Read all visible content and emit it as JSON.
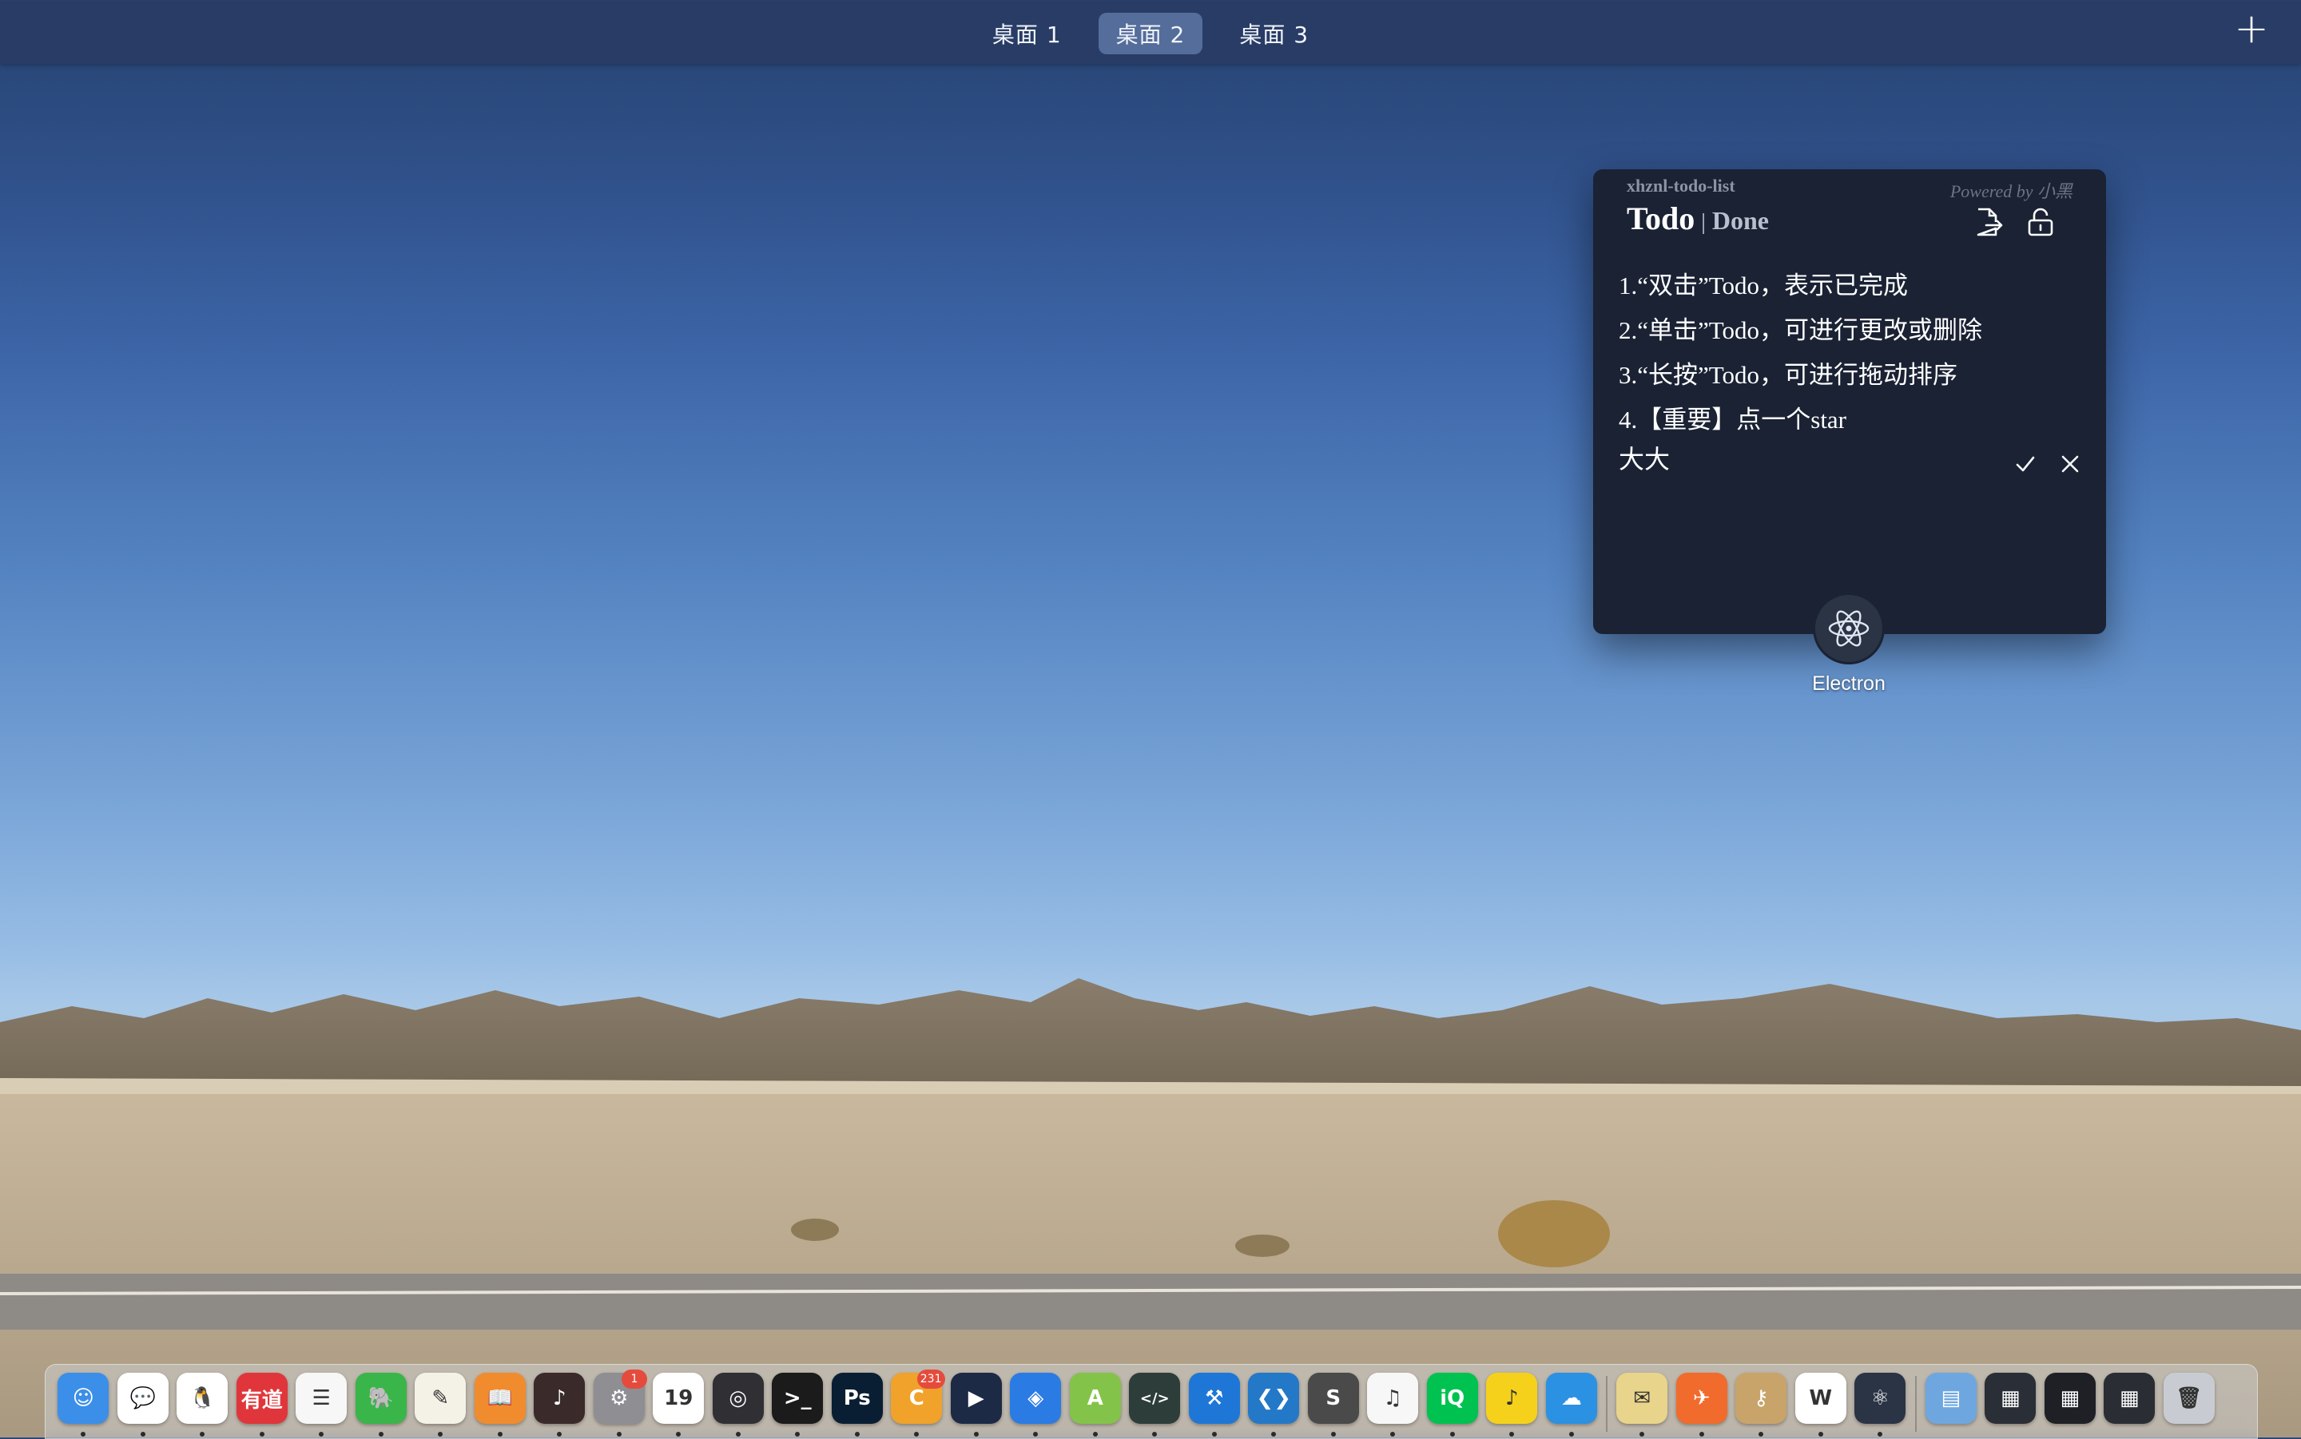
{
  "mission_control": {
    "spaces": [
      "桌面 1",
      "桌面 2",
      "桌面 3"
    ],
    "active_space": "桌面 2",
    "add_space_label": "+"
  },
  "todo_widget": {
    "app_name": "xhznl-todo-list",
    "powered_by": "Powered by 小黑",
    "tab_todo": "Todo",
    "tab_separator": "|",
    "tab_done": "Done",
    "icons": [
      "export-icon",
      "unlock-icon"
    ],
    "items": [
      "1.“双击”Todo，表示已完成",
      "2.“单击”Todo，可进行更改或删除",
      "3.“长按”Todo，可进行拖动排序",
      "4.【重要】点一个star"
    ],
    "edit_value": "大大",
    "edit_icons": [
      "check-icon",
      "close-icon"
    ]
  },
  "window_label": {
    "name": "Electron"
  },
  "dock": {
    "apps": [
      {
        "name": "Finder",
        "icon": "finder-icon",
        "color": "#3b8fe8",
        "glyph": "☺"
      },
      {
        "name": "WeChat",
        "icon": "wechat-icon",
        "color": "#ffffff",
        "glyph": "💬"
      },
      {
        "name": "QQ",
        "icon": "qq-icon",
        "color": "#ffffff",
        "glyph": "🐧"
      },
      {
        "name": "有道",
        "icon": "youdao-icon",
        "color": "#e0363b",
        "glyph": "有道"
      },
      {
        "name": "Reminders",
        "icon": "reminders-icon",
        "color": "#f7f7f7",
        "glyph": "☰"
      },
      {
        "name": "Evernote",
        "icon": "evernote-icon",
        "color": "#3ab54a",
        "glyph": "🐘"
      },
      {
        "name": "TextEdit",
        "icon": "textedit-icon",
        "color": "#f4f1e6",
        "glyph": "✎"
      },
      {
        "name": "Books",
        "icon": "books-icon",
        "color": "#f08c2e",
        "glyph": "📖"
      },
      {
        "name": "Activity",
        "icon": "activity-icon",
        "color": "#3a2a2a",
        "glyph": "♪"
      },
      {
        "name": "System Preferences",
        "icon": "settings-icon",
        "color": "#8e8e93",
        "glyph": "⚙",
        "badge": "1"
      },
      {
        "name": "Calendar",
        "icon": "calendar-icon",
        "color": "#ffffff",
        "glyph": "19"
      },
      {
        "name": "Instruments",
        "icon": "instruments-icon",
        "color": "#2f2f34",
        "glyph": "◎"
      },
      {
        "name": "Terminal",
        "icon": "terminal-icon",
        "color": "#1b1b1b",
        "glyph": ">_"
      },
      {
        "name": "Photoshop",
        "icon": "photoshop-icon",
        "color": "#0a1e33",
        "glyph": "Ps"
      },
      {
        "name": "Chrome Canary",
        "icon": "canary-icon",
        "color": "#f0a22b",
        "glyph": "C",
        "badge": "231"
      },
      {
        "name": "QuickTime",
        "icon": "quicktime-icon",
        "color": "#1d2a45",
        "glyph": "▶"
      },
      {
        "name": "Safari",
        "icon": "safari-icon",
        "color": "#2b7be4",
        "glyph": "◈"
      },
      {
        "name": "Android Studio",
        "icon": "android-studio-icon",
        "color": "#83c34a",
        "glyph": "A"
      },
      {
        "name": "Script Editor",
        "icon": "script-editor-icon",
        "color": "#2d3d3a",
        "glyph": "</>"
      },
      {
        "name": "Xcode",
        "icon": "xcode-icon",
        "color": "#1e77d6",
        "glyph": "⚒"
      },
      {
        "name": "VS Code",
        "icon": "vscode-icon",
        "color": "#2478c8",
        "glyph": "❮❯"
      },
      {
        "name": "Sublime Text",
        "icon": "sublime-icon",
        "color": "#4a4a4a",
        "glyph": "S"
      },
      {
        "name": "iTunes",
        "icon": "itunes-icon",
        "color": "#f7f7f7",
        "glyph": "♫"
      },
      {
        "name": "iQIYI",
        "icon": "iqiyi-icon",
        "color": "#00c250",
        "glyph": "iQ"
      },
      {
        "name": "QQ Music",
        "icon": "qqmusic-icon",
        "color": "#f5d11c",
        "glyph": "♪"
      },
      {
        "name": "Cloud",
        "icon": "cloud-icon",
        "color": "#2b91e3",
        "glyph": "☁"
      }
    ],
    "apps2": [
      {
        "name": "Stickies",
        "icon": "stickies-icon",
        "color": "#e8d48a",
        "glyph": "✉"
      },
      {
        "name": "Postman",
        "icon": "postman-icon",
        "color": "#f16b2c",
        "glyph": "✈"
      },
      {
        "name": "Keychain",
        "icon": "keychain-icon",
        "color": "#c8a46a",
        "glyph": "⚷"
      },
      {
        "name": "WPS",
        "icon": "wps-icon",
        "color": "#ffffff",
        "glyph": "W"
      },
      {
        "name": "Electron",
        "icon": "electron-icon",
        "color": "#2b3445",
        "glyph": "⚛"
      }
    ],
    "recent": [
      {
        "name": "Folder",
        "icon": "folder-icon",
        "color": "#6ea7e0",
        "glyph": "▤"
      },
      {
        "name": "Window",
        "icon": "window-thumb-icon",
        "color": "#2a2e36",
        "glyph": "▦"
      },
      {
        "name": "Window",
        "icon": "window-thumb-icon",
        "color": "#1e2026",
        "glyph": "▦"
      },
      {
        "name": "Electron...",
        "icon": "electron-thumb-icon",
        "color": "#2a2d33",
        "glyph": "▦"
      },
      {
        "name": "Trash",
        "icon": "trash-icon",
        "color": "#c8ccd2",
        "glyph": "🗑"
      }
    ]
  }
}
